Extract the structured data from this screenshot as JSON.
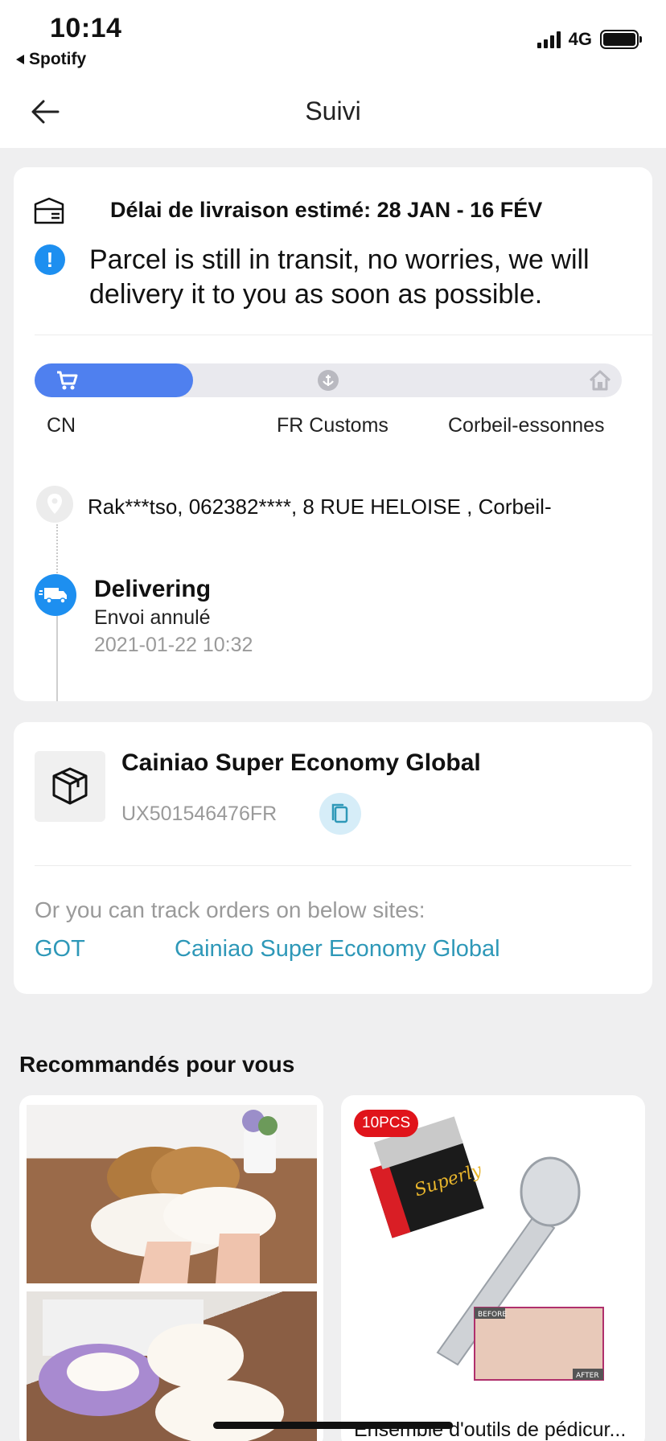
{
  "status_bar": {
    "time": "10:14",
    "back_app": "Spotify",
    "network": "4G"
  },
  "nav": {
    "title": "Suivi"
  },
  "tracking": {
    "eta": "Délai de livraison estimé: 28 JAN - 16 FÉV",
    "transit_message": "Parcel is still in transit, no worries, we will delivery it to you as soon as possible.",
    "progress": {
      "fraction": 0.27,
      "stops": [
        "CN",
        "FR Customs",
        "Corbeil-essonnes"
      ],
      "active_color": "#4f80ef"
    },
    "address": "Rak***tso,  062382****,  8 RUE HELOISE ,  Corbeil-",
    "event": {
      "title": "Delivering",
      "subtitle": "Envoi annulé",
      "datetime": "2021-01-22 10:32"
    }
  },
  "carrier": {
    "name": "Cainiao Super Economy Global",
    "tracking_number": "UX501546476FR",
    "track_hint": "Or you can track orders on below sites:",
    "links": [
      "GOT",
      "Cainiao Super Economy Global"
    ]
  },
  "recommendations": {
    "title": "Recommandés pour vous",
    "items": [
      {
        "name": ""
      },
      {
        "name": "Ensemble d'outils de pédicur...",
        "badge": "10PCS",
        "box_text": "Superly",
        "before": "BEFORE",
        "after": "AFTER"
      }
    ]
  },
  "colors": {
    "accent_blue": "#1d8ff0",
    "link": "#2e98b8",
    "badge_red": "#e0141b"
  }
}
